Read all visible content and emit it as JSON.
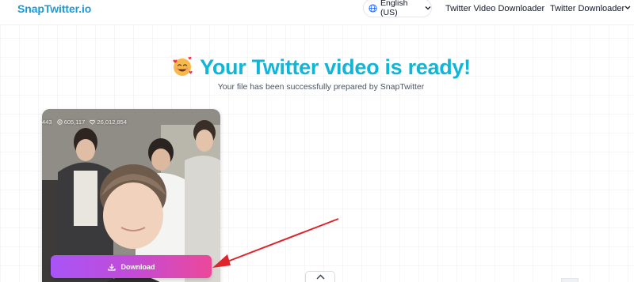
{
  "header": {
    "logo": "SnapTwitter.io",
    "language": {
      "label": "English (US)",
      "icon": "globe-icon"
    },
    "nav": {
      "video_downloader": "Twitter Video Downloader",
      "downloader": "Twitter Downloader"
    }
  },
  "hero": {
    "emoji": "smiling-face-with-hearts",
    "title": "Your Twitter video is ready!",
    "subtitle": "Your file has been successfully prepared by SnapTwitter"
  },
  "video": {
    "stats": {
      "first": "443",
      "views": "605,117",
      "likes": "26,012,854"
    },
    "download_label": "Download"
  },
  "colors": {
    "brand": "#1d9bd7",
    "title": "#11b5d7",
    "download_gradient_start": "#a855f7",
    "download_gradient_end": "#ec4899",
    "annotation_arrow": "#e0242b"
  }
}
